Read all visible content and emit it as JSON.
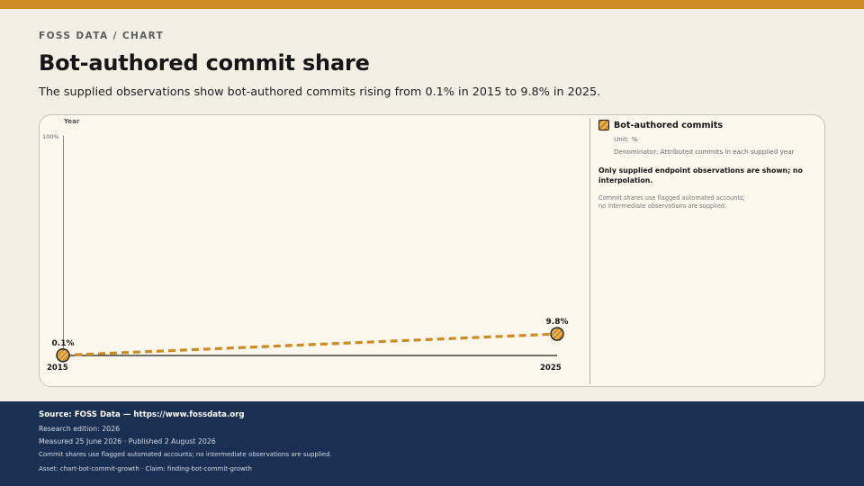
{
  "header": {
    "eyebrow": "FOSS DATA / CHART",
    "title": "Bot-authored commit share",
    "subtitle": "The supplied observations show bot-authored commits rising from 0.1% in 2015 to 9.8% in 2025."
  },
  "colors": {
    "accent": "#cf8a22",
    "background": "#f4efe4",
    "card": "#fcf8ee",
    "footer": "#1a3053"
  },
  "chart_data": {
    "type": "line",
    "x": [
      "2015",
      "2025"
    ],
    "series": [
      {
        "name": "Bot-authored commits",
        "values": [
          0.1,
          9.8
        ],
        "labels": [
          "0.1%",
          "9.8%"
        ],
        "style": "dashed",
        "color": "#cf8a22"
      }
    ],
    "xlabel": "",
    "ylabel": "Year",
    "ylim": [
      0,
      100
    ],
    "ytick_label": "100%",
    "x_tick_labels": [
      "2015",
      "2025"
    ],
    "grid": false
  },
  "legend": {
    "name": "Bot-authored commits",
    "unit": "Unit: %",
    "denominator": "Denominator: Attributed commits in each supplied year",
    "note": "Only supplied endpoint observations are shown; no interpolation.",
    "small": "Commit shares use flagged automated accounts; no intermediate observations are supplied."
  },
  "footer": {
    "source": "Source: FOSS Data — https://www.fossdata.org",
    "edition": "Research edition: 2026",
    "dates": "Measured 25 June 2026 · Published 2 August 2026",
    "method": "Commit shares use flagged automated accounts; no intermediate observations are supplied.",
    "asset": "Asset: chart-bot-commit-growth · Claim: finding-bot-commit-growth"
  }
}
